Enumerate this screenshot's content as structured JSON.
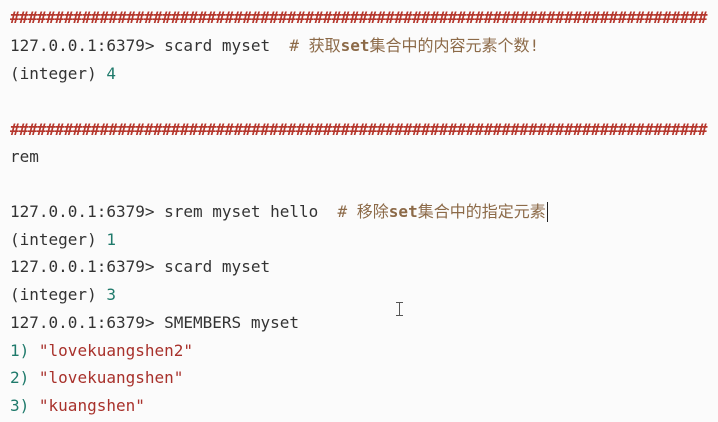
{
  "separator": "##############################################################################",
  "lines": {
    "scard_cmd": "127.0.0.1:6379> scard myset",
    "scard_comment_hash": "# 获取",
    "scard_comment_kw": "set",
    "scard_comment_rest": "集合中的内容元素个数!",
    "scard_result_prefix": "(integer) ",
    "scard_result_value": "4",
    "section_title": "rem",
    "srem_cmd": "127.0.0.1:6379> srem myset hello",
    "srem_comment_hash": "# 移除",
    "srem_comment_kw": "set",
    "srem_comment_rest": "集合中的指定元素",
    "srem_result_prefix": "(integer) ",
    "srem_result_value": "1",
    "scard2_cmd": "127.0.0.1:6379> scard myset",
    "scard2_result_prefix": "(integer) ",
    "scard2_result_value": "3",
    "smembers_cmd": "127.0.0.1:6379> SMEMBERS myset",
    "member1_index": "1) ",
    "member1_value": "\"lovekuangshen2\"",
    "member2_index": "2) ",
    "member2_value": "\"lovekuangshen\"",
    "member3_index": "3) ",
    "member3_value": "\"kuangshen\""
  },
  "colors": {
    "separator": "#b5362c",
    "comment": "#8c6a48",
    "number": "#1f7a6b",
    "string": "#a8312b",
    "text": "#333333"
  },
  "icons": {
    "text_caret": "text-caret-icon",
    "mouse_cursor": "ibeam-cursor-icon"
  }
}
